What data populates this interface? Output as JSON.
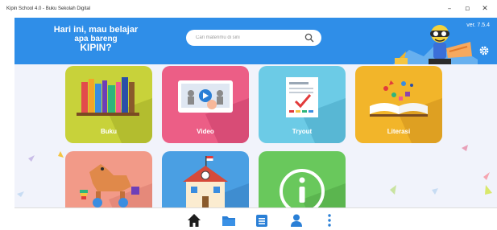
{
  "window": {
    "title": "Kipin School 4.0 - Buku Sekolah Digital",
    "minimize": "–",
    "maximize": "▫",
    "close": "✕"
  },
  "header": {
    "greeting_line1": "Hari ini, mau belajar",
    "greeting_line2": "apa bareng",
    "greeting_line3": "KIPIN?",
    "search_placeholder": "Cari materimu di sini",
    "version": "ver. 7.5.4"
  },
  "menu": {
    "tiles": [
      {
        "label": "Buku",
        "color": "#c8d23a"
      },
      {
        "label": "Video",
        "color": "#ec5e86"
      },
      {
        "label": "Tryout",
        "color": "#6ccbe6"
      },
      {
        "label": "Literasi",
        "color": "#f2b52a"
      },
      {
        "label": "",
        "color": "#f29a88"
      },
      {
        "label": "",
        "color": "#4a9fe3"
      },
      {
        "label": "",
        "color": "#69c85c"
      }
    ]
  },
  "bottom_nav": {
    "items": [
      "home-icon",
      "folder-icon",
      "list-icon",
      "profile-icon",
      "more-icon"
    ],
    "accent": "#2a7fd6",
    "home_color": "#1d1d1d"
  },
  "colors": {
    "header_bg": "#2f8ee8",
    "content_bg": "#f1f3fb"
  }
}
